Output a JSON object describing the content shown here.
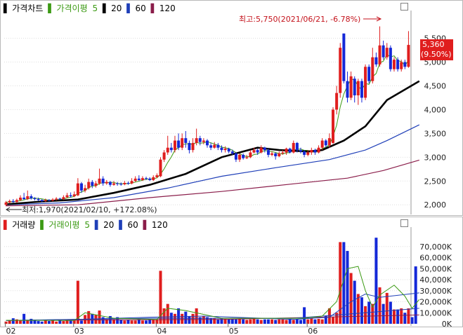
{
  "price_legend": {
    "title": "가격차트",
    "ma_label": "가격이평",
    "ma_periods": [
      "5",
      "20",
      "60",
      "120"
    ]
  },
  "volume_legend": {
    "title": "거래량",
    "ma_label": "거래이평",
    "ma_periods": [
      "5",
      "20",
      "60",
      "120"
    ]
  },
  "colors": {
    "up": "#e01e1e",
    "down": "#1428d8",
    "ma5": "#3c9a14",
    "ma20": "#000000",
    "ma60": "#1f3fb8",
    "ma120": "#8a1d4a",
    "annotation": "#c4121b"
  },
  "annotations": {
    "high": "최고:5,750(2021/06/21, -6.78%)",
    "low": "최저:1,970(2021/02/10, +172.08%)",
    "current_price": "5,360",
    "current_change": "(9.50%)"
  },
  "chart_data": [
    {
      "type": "candlestick",
      "title": "가격차트",
      "ylim": [
        1900,
        5700
      ],
      "y_ticks": [
        "2,000",
        "2,500",
        "3,000",
        "3,500",
        "4,000",
        "4,500",
        "5,000",
        "5,500"
      ],
      "x_ticks": [
        "02",
        "03",
        "04",
        "05",
        "06"
      ],
      "grid": true,
      "candles": [
        {
          "o": 2000,
          "c": 2050,
          "h": 2080,
          "l": 1970
        },
        {
          "o": 2050,
          "c": 2080,
          "h": 2110,
          "l": 2030
        },
        {
          "o": 2080,
          "c": 2060,
          "h": 2120,
          "l": 2040
        },
        {
          "o": 2060,
          "c": 2100,
          "h": 2130,
          "l": 2040
        },
        {
          "o": 2100,
          "c": 2150,
          "h": 2200,
          "l": 2080
        },
        {
          "o": 2150,
          "c": 2120,
          "h": 2250,
          "l": 2100
        },
        {
          "o": 2120,
          "c": 2180,
          "h": 2300,
          "l": 2100
        },
        {
          "o": 2180,
          "c": 2140,
          "h": 2220,
          "l": 2110
        },
        {
          "o": 2140,
          "c": 2120,
          "h": 2160,
          "l": 2090
        },
        {
          "o": 2120,
          "c": 2100,
          "h": 2150,
          "l": 2080
        },
        {
          "o": 2100,
          "c": 2080,
          "h": 2120,
          "l": 2050
        },
        {
          "o": 2080,
          "c": 2100,
          "h": 2130,
          "l": 2060
        },
        {
          "o": 2100,
          "c": 2090,
          "h": 2120,
          "l": 2070
        },
        {
          "o": 2090,
          "c": 2110,
          "h": 2140,
          "l": 2070
        },
        {
          "o": 2110,
          "c": 2130,
          "h": 2160,
          "l": 2090
        },
        {
          "o": 2130,
          "c": 2120,
          "h": 2150,
          "l": 2100
        },
        {
          "o": 2120,
          "c": 2160,
          "h": 2200,
          "l": 2100
        },
        {
          "o": 2160,
          "c": 2200,
          "h": 2250,
          "l": 2140
        },
        {
          "o": 2200,
          "c": 2180,
          "h": 2260,
          "l": 2150
        },
        {
          "o": 2180,
          "c": 2220,
          "h": 2280,
          "l": 2160
        },
        {
          "o": 2200,
          "c": 2450,
          "h": 2560,
          "l": 2180
        },
        {
          "o": 2450,
          "c": 2300,
          "h": 2480,
          "l": 2250
        },
        {
          "o": 2300,
          "c": 2350,
          "h": 2420,
          "l": 2260
        },
        {
          "o": 2350,
          "c": 2480,
          "h": 2550,
          "l": 2320
        },
        {
          "o": 2480,
          "c": 2400,
          "h": 2520,
          "l": 2350
        },
        {
          "o": 2400,
          "c": 2450,
          "h": 2500,
          "l": 2360
        },
        {
          "o": 2450,
          "c": 2550,
          "h": 2760,
          "l": 2420
        },
        {
          "o": 2550,
          "c": 2450,
          "h": 2600,
          "l": 2400
        },
        {
          "o": 2450,
          "c": 2480,
          "h": 2520,
          "l": 2420
        },
        {
          "o": 2480,
          "c": 2420,
          "h": 2500,
          "l": 2380
        },
        {
          "o": 2420,
          "c": 2450,
          "h": 2500,
          "l": 2400
        },
        {
          "o": 2450,
          "c": 2440,
          "h": 2480,
          "l": 2400
        },
        {
          "o": 2440,
          "c": 2430,
          "h": 2470,
          "l": 2400
        },
        {
          "o": 2430,
          "c": 2460,
          "h": 2500,
          "l": 2410
        },
        {
          "o": 2460,
          "c": 2450,
          "h": 2490,
          "l": 2420
        },
        {
          "o": 2450,
          "c": 2500,
          "h": 2560,
          "l": 2430
        },
        {
          "o": 2500,
          "c": 2550,
          "h": 2600,
          "l": 2480
        },
        {
          "o": 2550,
          "c": 2520,
          "h": 2620,
          "l": 2500
        },
        {
          "o": 2520,
          "c": 2560,
          "h": 2600,
          "l": 2500
        },
        {
          "o": 2560,
          "c": 2550,
          "h": 2590,
          "l": 2520
        },
        {
          "o": 2550,
          "c": 2520,
          "h": 2580,
          "l": 2500
        },
        {
          "o": 2520,
          "c": 2580,
          "h": 2620,
          "l": 2500
        },
        {
          "o": 2580,
          "c": 2620,
          "h": 2660,
          "l": 2560
        },
        {
          "o": 2600,
          "c": 2950,
          "h": 3000,
          "l": 2580
        },
        {
          "o": 2950,
          "c": 3100,
          "h": 3150,
          "l": 2900
        },
        {
          "o": 3100,
          "c": 3200,
          "h": 3450,
          "l": 3050
        },
        {
          "o": 3200,
          "c": 3150,
          "h": 3300,
          "l": 3100
        },
        {
          "o": 3150,
          "c": 3350,
          "h": 3450,
          "l": 3100
        },
        {
          "o": 3350,
          "c": 3200,
          "h": 3500,
          "l": 3150
        },
        {
          "o": 3200,
          "c": 3400,
          "h": 3500,
          "l": 3150
        },
        {
          "o": 3400,
          "c": 3300,
          "h": 3550,
          "l": 3200
        },
        {
          "o": 3300,
          "c": 3150,
          "h": 3350,
          "l": 3080
        },
        {
          "o": 3150,
          "c": 3300,
          "h": 3400,
          "l": 3100
        },
        {
          "o": 3300,
          "c": 3400,
          "h": 3600,
          "l": 3250
        },
        {
          "o": 3400,
          "c": 3320,
          "h": 3450,
          "l": 3250
        },
        {
          "o": 3320,
          "c": 3350,
          "h": 3400,
          "l": 3270
        },
        {
          "o": 3350,
          "c": 3250,
          "h": 3380,
          "l": 3200
        },
        {
          "o": 3250,
          "c": 3200,
          "h": 3300,
          "l": 3150
        },
        {
          "o": 3200,
          "c": 3260,
          "h": 3320,
          "l": 3180
        },
        {
          "o": 3260,
          "c": 3200,
          "h": 3300,
          "l": 3150
        },
        {
          "o": 3200,
          "c": 3150,
          "h": 3250,
          "l": 3100
        },
        {
          "o": 3150,
          "c": 3180,
          "h": 3230,
          "l": 3100
        },
        {
          "o": 3180,
          "c": 3120,
          "h": 3200,
          "l": 3080
        },
        {
          "o": 3120,
          "c": 3080,
          "h": 3160,
          "l": 3050
        },
        {
          "o": 3080,
          "c": 2950,
          "h": 3100,
          "l": 2900
        },
        {
          "o": 2950,
          "c": 3050,
          "h": 3080,
          "l": 2900
        },
        {
          "o": 3050,
          "c": 2980,
          "h": 3080,
          "l": 2950
        },
        {
          "o": 2980,
          "c": 3000,
          "h": 3050,
          "l": 2960
        },
        {
          "o": 3000,
          "c": 3100,
          "h": 3150,
          "l": 2980
        },
        {
          "o": 3100,
          "c": 3150,
          "h": 3200,
          "l": 3080
        },
        {
          "o": 3150,
          "c": 3100,
          "h": 3180,
          "l": 3050
        },
        {
          "o": 3100,
          "c": 3200,
          "h": 3250,
          "l": 3080
        },
        {
          "o": 3200,
          "c": 3150,
          "h": 3220,
          "l": 3100
        },
        {
          "o": 3150,
          "c": 3050,
          "h": 3180,
          "l": 3000
        },
        {
          "o": 3050,
          "c": 3080,
          "h": 3120,
          "l": 3020
        },
        {
          "o": 3080,
          "c": 3020,
          "h": 3100,
          "l": 2950
        },
        {
          "o": 3020,
          "c": 3080,
          "h": 3120,
          "l": 3000
        },
        {
          "o": 3080,
          "c": 3100,
          "h": 3150,
          "l": 3050
        },
        {
          "o": 3100,
          "c": 3180,
          "h": 3200,
          "l": 3050
        },
        {
          "o": 3180,
          "c": 3100,
          "h": 3200,
          "l": 3080
        },
        {
          "o": 3100,
          "c": 3300,
          "h": 3350,
          "l": 3080
        },
        {
          "o": 3300,
          "c": 3150,
          "h": 3320,
          "l": 3100
        },
        {
          "o": 3150,
          "c": 3120,
          "h": 3200,
          "l": 3080
        },
        {
          "o": 3120,
          "c": 3050,
          "h": 3150,
          "l": 3000
        },
        {
          "o": 3050,
          "c": 3100,
          "h": 3150,
          "l": 3020
        },
        {
          "o": 3100,
          "c": 3150,
          "h": 3200,
          "l": 3050
        },
        {
          "o": 3150,
          "c": 3100,
          "h": 3180,
          "l": 3050
        },
        {
          "o": 3100,
          "c": 3200,
          "h": 3250,
          "l": 3080
        },
        {
          "o": 3200,
          "c": 3350,
          "h": 3400,
          "l": 3150
        },
        {
          "o": 3350,
          "c": 3250,
          "h": 3380,
          "l": 3200
        },
        {
          "o": 3250,
          "c": 3400,
          "h": 3500,
          "l": 3200
        },
        {
          "o": 3300,
          "c": 4000,
          "h": 4050,
          "l": 3280
        },
        {
          "o": 4000,
          "c": 4350,
          "h": 4500,
          "l": 3900
        },
        {
          "o": 4350,
          "c": 5300,
          "h": 5400,
          "l": 4250
        },
        {
          "o": 5600,
          "c": 4600,
          "h": 5600,
          "l": 4550
        },
        {
          "o": 4600,
          "c": 4250,
          "h": 4800,
          "l": 4150
        },
        {
          "o": 4250,
          "c": 4700,
          "h": 4800,
          "l": 4200
        },
        {
          "o": 4650,
          "c": 4300,
          "h": 4700,
          "l": 4150
        },
        {
          "o": 4300,
          "c": 4600,
          "h": 4650,
          "l": 4100
        },
        {
          "o": 4600,
          "c": 4250,
          "h": 4650,
          "l": 4150
        },
        {
          "o": 4250,
          "c": 4900,
          "h": 4950,
          "l": 4200
        },
        {
          "o": 4900,
          "c": 4600,
          "h": 4950,
          "l": 4550
        },
        {
          "o": 4600,
          "c": 5100,
          "h": 5300,
          "l": 4550
        },
        {
          "o": 5100,
          "c": 4950,
          "h": 5200,
          "l": 4900
        },
        {
          "o": 4950,
          "c": 5350,
          "h": 5750,
          "l": 4900
        },
        {
          "o": 5350,
          "c": 5100,
          "h": 5450,
          "l": 5050
        },
        {
          "o": 5100,
          "c": 5300,
          "h": 5400,
          "l": 5050
        },
        {
          "o": 5300,
          "c": 4850,
          "h": 5350,
          "l": 4800
        },
        {
          "o": 4850,
          "c": 5050,
          "h": 5100,
          "l": 4800
        },
        {
          "o": 5050,
          "c": 4850,
          "h": 5100,
          "l": 4800
        },
        {
          "o": 4850,
          "c": 5000,
          "h": 5050,
          "l": 4800
        },
        {
          "o": 5000,
          "c": 4900,
          "h": 5050,
          "l": 4850
        },
        {
          "o": 4900,
          "c": 5360,
          "h": 5650,
          "l": 4880
        }
      ],
      "ma": {
        "ma20": {
          "points": [
            [
              0,
              2010
            ],
            [
              10,
              2070
            ],
            [
              20,
              2110
            ],
            [
              30,
              2250
            ],
            [
              40,
              2420
            ],
            [
              50,
              2650
            ],
            [
              60,
              3000
            ],
            [
              70,
              3200
            ],
            [
              76,
              3150
            ],
            [
              84,
              3120
            ],
            [
              88,
              3150
            ],
            [
              94,
              3350
            ],
            [
              100,
              3650
            ],
            [
              106,
              4200
            ],
            [
              115,
              4600
            ]
          ]
        },
        "ma60": {
          "points": [
            [
              0,
              2000
            ],
            [
              15,
              2040
            ],
            [
              30,
              2150
            ],
            [
              45,
              2350
            ],
            [
              60,
              2600
            ],
            [
              75,
              2780
            ],
            [
              90,
              2950
            ],
            [
              100,
              3150
            ],
            [
              106,
              3350
            ],
            [
              115,
              3680
            ]
          ]
        },
        "ma120": {
          "points": [
            [
              0,
              1980
            ],
            [
              20,
              2000
            ],
            [
              40,
              2150
            ],
            [
              60,
              2280
            ],
            [
              80,
              2440
            ],
            [
              95,
              2560
            ],
            [
              105,
              2720
            ],
            [
              115,
              2940
            ]
          ]
        }
      }
    },
    {
      "type": "bar",
      "title": "거래량",
      "ylim": [
        0,
        80000
      ],
      "y_ticks": [
        "0K",
        "10,000K",
        "20,000K",
        "30,000K",
        "40,000K",
        "50,000K",
        "60,000K",
        "70,000K"
      ],
      "values": [
        2000,
        3500,
        5000,
        4000,
        3000,
        9000,
        3500,
        4500,
        3000,
        2500,
        2000,
        3000,
        2500,
        3000,
        2000,
        3000,
        2500,
        3500,
        3000,
        3500,
        39000,
        3000,
        8000,
        11500,
        9000,
        8000,
        12000,
        6000,
        4000,
        7000,
        4000,
        6000,
        3500,
        3000,
        3500,
        3000,
        3000,
        4000,
        3000,
        3000,
        3500,
        3500,
        4000,
        48000,
        14000,
        18000,
        10000,
        9000,
        14000,
        9000,
        11000,
        7000,
        9000,
        14000,
        6000,
        7000,
        6000,
        5000,
        5000,
        4000,
        5000,
        4500,
        4000,
        4500,
        4000,
        4500,
        4000,
        3500,
        4000,
        4500,
        4000,
        3500,
        4000,
        4000,
        4000,
        3500,
        4000,
        4000,
        3500,
        4500,
        3500,
        4000,
        3500,
        15000,
        4000,
        5000,
        4000,
        4500,
        4000,
        7000,
        14000,
        6000,
        10000,
        74000,
        74000,
        66000,
        46000,
        39000,
        27000,
        24000,
        16000,
        20000,
        18000,
        78000,
        33000,
        18000,
        28000,
        20000,
        13000,
        13000,
        14000,
        10000,
        14000,
        6000,
        52000
      ],
      "ma": {
        "ma5": {
          "points": [
            [
              0,
              3200
            ],
            [
              19,
              3000
            ],
            [
              22,
              10000
            ],
            [
              30,
              5000
            ],
            [
              42,
              4000
            ],
            [
              45,
              14000
            ],
            [
              50,
              12000
            ],
            [
              60,
              5000
            ],
            [
              83,
              5000
            ],
            [
              88,
              7000
            ],
            [
              92,
              20000
            ],
            [
              95,
              50000
            ],
            [
              98,
              52000
            ],
            [
              100,
              30000
            ],
            [
              102,
              15000
            ],
            [
              104,
              26000
            ],
            [
              108,
              35000
            ],
            [
              111,
              25000
            ],
            [
              113,
              14000
            ],
            [
              115,
              22000
            ]
          ]
        },
        "ma20": {
          "points": [
            [
              0,
              3000
            ],
            [
              20,
              4000
            ],
            [
              40,
              6000
            ],
            [
              55,
              7000
            ],
            [
              80,
              4000
            ],
            [
              90,
              6000
            ],
            [
              96,
              20000
            ],
            [
              100,
              27000
            ],
            [
              104,
              24000
            ],
            [
              115,
              28000
            ]
          ]
        },
        "ma60": {
          "points": [
            [
              0,
              3000
            ],
            [
              40,
              5000
            ],
            [
              80,
              5000
            ],
            [
              100,
              10000
            ],
            [
              115,
              14000
            ]
          ]
        },
        "ma120": {
          "points": [
            [
              0,
              3000
            ],
            [
              60,
              4000
            ],
            [
              115,
              8000
            ]
          ]
        }
      }
    }
  ]
}
